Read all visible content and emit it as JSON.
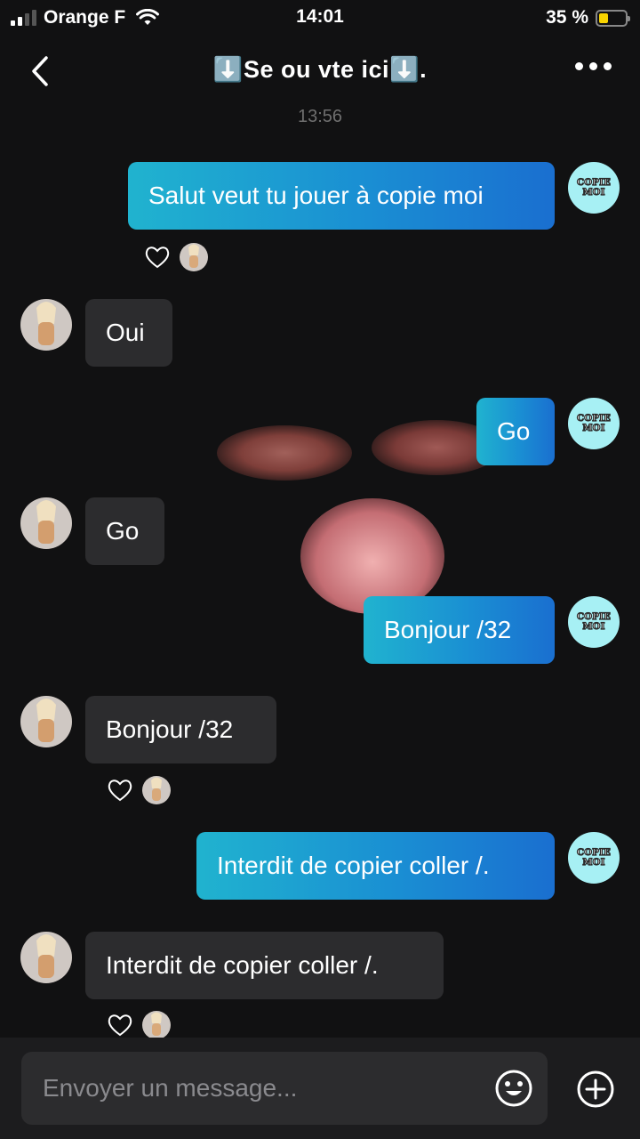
{
  "status_bar": {
    "carrier": "Orange F",
    "time": "14:01",
    "battery": "35 %",
    "battery_level": 0.35
  },
  "header": {
    "title": "⬇️Se ou vte ici⬇️."
  },
  "timestamp": "13:56",
  "avatars": {
    "copie_line1": "COPIE",
    "copie_line2": "MOI"
  },
  "messages": [
    {
      "side": "out",
      "text": "Salut veut tu jouer à copie moi"
    },
    {
      "side": "in",
      "text": "Oui"
    },
    {
      "side": "out",
      "text": "Go"
    },
    {
      "side": "in",
      "text": "Go"
    },
    {
      "side": "out",
      "text": "Bonjour /32"
    },
    {
      "side": "in",
      "text": "Bonjour /32"
    },
    {
      "side": "out",
      "text": "Interdit de copier coller /."
    },
    {
      "side": "in",
      "text": "Interdit de copier coller /."
    }
  ],
  "input": {
    "placeholder": "Envoyer un message..."
  },
  "icons": {
    "back": "chevron-left-icon",
    "more": "more-dots-icon",
    "heart": "heart-icon",
    "emoji": "emoji-icon",
    "add": "plus-circle-icon"
  },
  "colors": {
    "background": "#111112",
    "outgoing_bubble": "#1a8fd3",
    "incoming_bubble": "#2c2c2e",
    "copie_avatar": "#a7f0f4"
  }
}
